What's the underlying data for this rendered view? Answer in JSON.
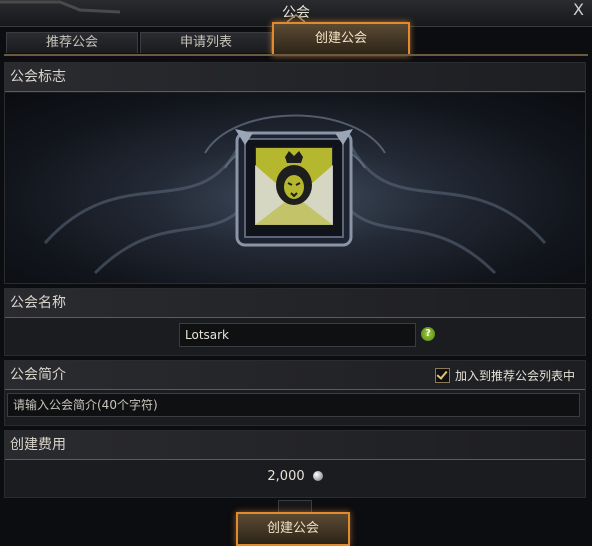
{
  "window": {
    "title": "公会",
    "close_label": "X"
  },
  "tabs": [
    {
      "label": "推荐公会",
      "active": false
    },
    {
      "label": "申请列表",
      "active": false
    },
    {
      "label": "创建公会",
      "active": true
    }
  ],
  "emblem_section": {
    "header": "公会标志"
  },
  "name_section": {
    "header": "公会名称",
    "name_value": "Lotsark",
    "help_icon": "question-icon"
  },
  "intro_section": {
    "header": "公会简介",
    "recommend_label": "加入到推荐公会列表中",
    "recommend_checked": true,
    "intro_placeholder": "请输入公会简介(40个字符)"
  },
  "cost_section": {
    "header": "创建费用",
    "amount": "2,000",
    "currency_icon": "silver-coin-icon"
  },
  "create_button": {
    "label": "创建公会"
  },
  "colors": {
    "accent": "#e38a2d",
    "emblem_bg": "#b5b82e",
    "divider": "#6b5a3f"
  }
}
